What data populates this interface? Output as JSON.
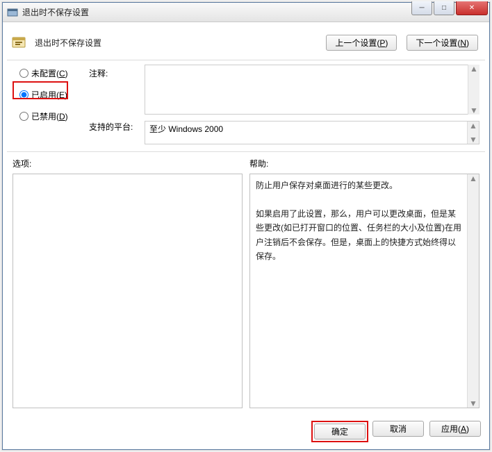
{
  "window": {
    "title": "退出时不保存设置"
  },
  "header": {
    "title": "退出时不保存设置",
    "prev_btn": "上一个设置(",
    "prev_key": "P",
    "prev_btn_end": ")",
    "next_btn": "下一个设置(",
    "next_key": "N",
    "next_btn_end": ")"
  },
  "radios": {
    "not_configured": "未配置(",
    "not_configured_key": "C",
    "not_configured_end": ")",
    "enabled": "已启用(",
    "enabled_key": "E",
    "enabled_end": ")",
    "disabled": "已禁用(",
    "disabled_key": "D",
    "disabled_end": ")"
  },
  "labels": {
    "comment": "注释:",
    "platform": "支持的平台:"
  },
  "fields": {
    "comment_value": "",
    "platform_value": "至少 Windows 2000"
  },
  "split": {
    "options_label": "选项:",
    "help_label": "帮助:"
  },
  "help": {
    "p1": "防止用户保存对桌面进行的某些更改。",
    "p2": "如果启用了此设置，那么，用户可以更改桌面，但是某些更改(如已打开窗口的位置、任务栏的大小及位置)在用户注销后不会保存。但是，桌面上的快捷方式始终得以保存。"
  },
  "buttons": {
    "ok": "确定",
    "cancel": "取消",
    "apply": "应用(",
    "apply_key": "A",
    "apply_end": ")"
  }
}
